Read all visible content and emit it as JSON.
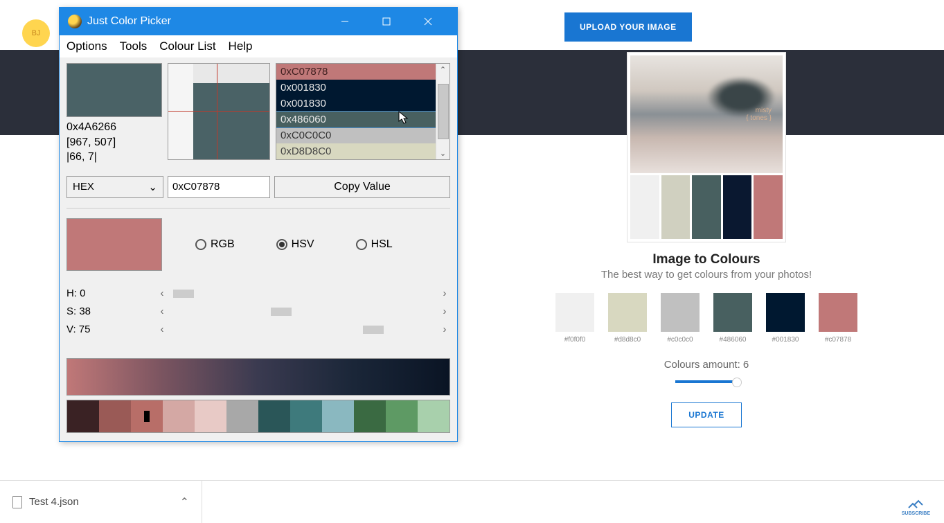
{
  "avatar_initials": "BJ",
  "upload_button": "UPLOAD YOUR IMAGE",
  "window": {
    "title": "Just Color Picker",
    "menu": [
      "Options",
      "Tools",
      "Colour List",
      "Help"
    ],
    "current_hex": "0x4A6266",
    "current_coord": "[967, 507]",
    "current_offset": "|66, 7|",
    "picked_swatch_color": "#4a6266",
    "format_sel": "HEX",
    "format_value": "0xC07878",
    "copy_label": "Copy Value",
    "history": [
      {
        "label": "0xC07878",
        "bg": "#c07878",
        "fg": "#402020"
      },
      {
        "label": "0x001830",
        "bg": "#001830",
        "fg": "#e8e8e8"
      },
      {
        "label": "0x001830",
        "bg": "#001830",
        "fg": "#e8e8e8"
      },
      {
        "label": "0x486060",
        "bg": "#486060",
        "fg": "#e8e8e8",
        "selected": true
      },
      {
        "label": "0xC0C0C0",
        "bg": "#c0c0c0",
        "fg": "#333"
      },
      {
        "label": "0xD8D8C0",
        "bg": "#d8d8c0",
        "fg": "#444"
      }
    ],
    "model_swatch": "#c07878",
    "models": [
      {
        "label": "RGB",
        "on": false
      },
      {
        "label": "HSV",
        "on": true
      },
      {
        "label": "HSL",
        "on": false
      }
    ],
    "sliders": [
      {
        "label": "H: 0",
        "pos": 2
      },
      {
        "label": "S: 38",
        "pos": 38
      },
      {
        "label": "V: 75",
        "pos": 72
      }
    ],
    "palette": [
      "#3a2224",
      "#9a5a56",
      "#b86e68",
      "#d4a8a4",
      "#e8cac6",
      "#a8a8a8",
      "#2a5658",
      "#3e7a7c",
      "#8ab8c0",
      "#3a6a42",
      "#5e9a64",
      "#a8d0ac"
    ],
    "marker_index": 2
  },
  "web": {
    "image_caption_1": "misty",
    "image_caption_2": "{ tones }",
    "image_swatches": [
      "#f0f0f0",
      "#d0d0c0",
      "#486060",
      "#0a1830",
      "#c07878"
    ],
    "title": "Image to Colours",
    "subtitle": "The best way to get colours from your photos!",
    "extracted": [
      {
        "hex": "#f0f0f0",
        "label": "#f0f0f0"
      },
      {
        "hex": "#d8d8c0",
        "label": "#d8d8c0"
      },
      {
        "hex": "#c0c0c0",
        "label": "#c0c0c0"
      },
      {
        "hex": "#486060",
        "label": "#486060"
      },
      {
        "hex": "#001830",
        "label": "#001830"
      },
      {
        "hex": "#c07878",
        "label": "#c07878"
      }
    ],
    "amount_label": "Colours amount: 6",
    "update_label": "UPDATE"
  },
  "bottom_file": "Test 4.json",
  "subscribe": "SUBSCRIBE"
}
